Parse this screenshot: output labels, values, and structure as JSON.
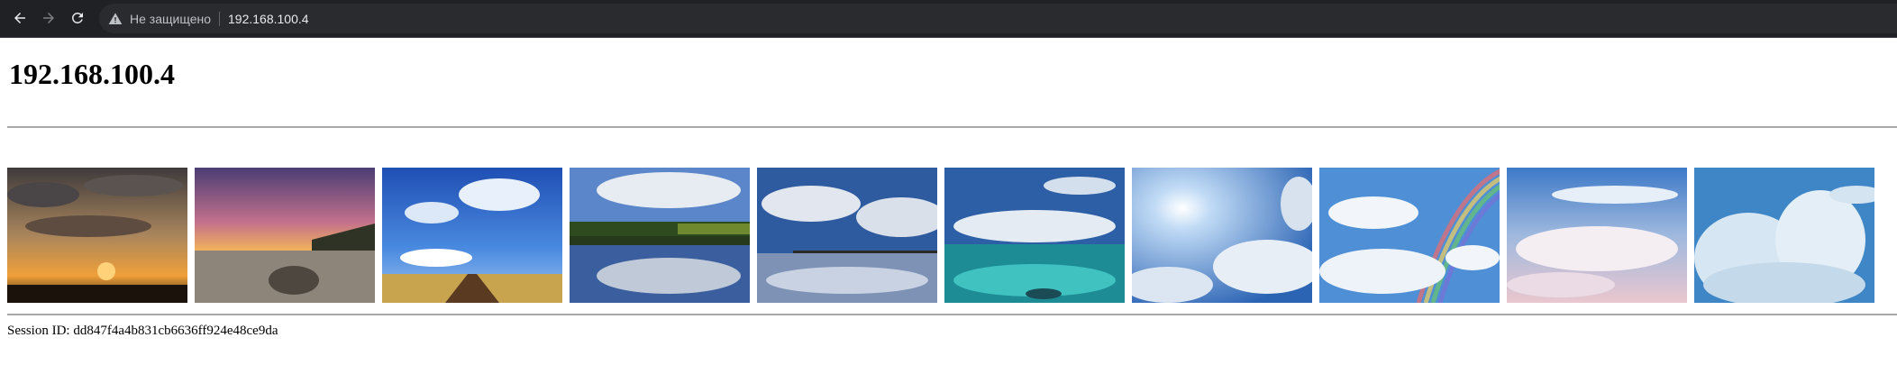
{
  "browser": {
    "security_status": "Не защищено",
    "url": "192.168.100.4",
    "icons": {
      "back": "arrow-left-icon",
      "forward": "arrow-right-icon",
      "reload": "reload-icon",
      "warning": "warning-triangle-icon"
    }
  },
  "page": {
    "title": "192.168.100.4",
    "session_label": "Session ID: dd847f4a4b831cb6636ff924e48ce9da",
    "images": [
      {
        "name": "sunset-clouds-city"
      },
      {
        "name": "sunset-beach-rock"
      },
      {
        "name": "blue-sky-railroad"
      },
      {
        "name": "lake-reflection-forest"
      },
      {
        "name": "sea-pier-clouds"
      },
      {
        "name": "turquoise-sea-clouds"
      },
      {
        "name": "sun-rays-clouds"
      },
      {
        "name": "clouds-rainbow"
      },
      {
        "name": "pastel-sky-clouds"
      },
      {
        "name": "towering-clouds"
      }
    ]
  },
  "colors": {
    "toolbar_bg": "#202124",
    "omnibox_bg": "#2a2b2e",
    "rule": "#a8a8a8"
  }
}
